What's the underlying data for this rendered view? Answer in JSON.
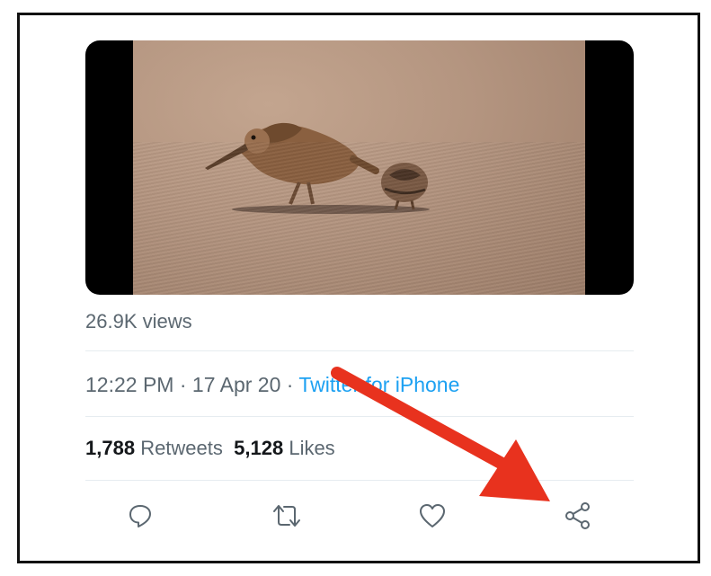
{
  "tweet": {
    "views": "26.9K views",
    "time": "12:22 PM",
    "separator": " · ",
    "date": "17 Apr 20",
    "source_separator": " · ",
    "source": "Twitter for iPhone",
    "retweets_count": "1,788",
    "retweets_label": "Retweets",
    "likes_count": "5,128",
    "likes_label": "Likes"
  },
  "actions": {
    "reply": "reply-icon",
    "retweet": "retweet-icon",
    "like": "heart-icon",
    "share": "share-icon"
  },
  "colors": {
    "link": "#1da1f2",
    "muted": "#5b6770",
    "arrow": "#e8321e"
  }
}
